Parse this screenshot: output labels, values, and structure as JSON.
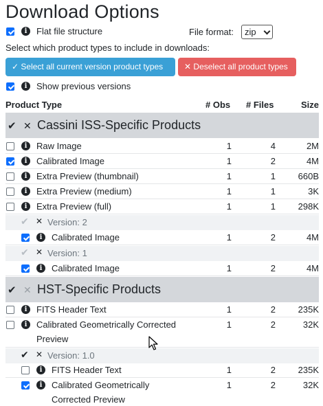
{
  "title": "Download Options",
  "flat_file": {
    "label": "Flat file structure",
    "checked": true
  },
  "file_format": {
    "label": "File format:",
    "value": "zip"
  },
  "select_prompt": "Select which product types to include in downloads:",
  "buttons": {
    "select_all": "Select all current version product types",
    "deselect_all": "Deselect all product types"
  },
  "show_prev": {
    "label": "Show previous versions",
    "checked": true
  },
  "table_headers": {
    "product_type": "Product Type",
    "obs": "# Obs",
    "files": "# Files",
    "size": "Size"
  },
  "sections": [
    {
      "title": "Cassini ISS-Specific Products",
      "rows": [
        {
          "name": "Raw Image",
          "checked": false,
          "obs": "1",
          "files": "4",
          "size": "2M"
        },
        {
          "name": "Calibrated Image",
          "checked": true,
          "obs": "1",
          "files": "2",
          "size": "4M"
        },
        {
          "name": "Extra Preview (thumbnail)",
          "checked": false,
          "obs": "1",
          "files": "1",
          "size": "660B"
        },
        {
          "name": "Extra Preview (medium)",
          "checked": false,
          "obs": "1",
          "files": "1",
          "size": "3K"
        },
        {
          "name": "Extra Preview (full)",
          "checked": false,
          "obs": "1",
          "files": "1",
          "size": "298K"
        }
      ],
      "versions": [
        {
          "label": "Version: 2",
          "rows": [
            {
              "name": "Calibrated Image",
              "checked": true,
              "obs": "1",
              "files": "2",
              "size": "4M"
            }
          ]
        },
        {
          "label": "Version: 1",
          "rows": [
            {
              "name": "Calibrated Image",
              "checked": true,
              "obs": "1",
              "files": "2",
              "size": "4M"
            }
          ]
        }
      ]
    },
    {
      "title": "HST-Specific Products",
      "rows": [
        {
          "name": "FITS Header Text",
          "checked": false,
          "obs": "1",
          "files": "2",
          "size": "235K"
        },
        {
          "name_line1": "Calibrated Geometrically Corrected",
          "name_line2": "Preview",
          "checked": false,
          "obs": "1",
          "files": "2",
          "size": "32K"
        }
      ],
      "versions": [
        {
          "label": "Version: 1.0",
          "rows": [
            {
              "name": "FITS Header Text",
              "checked": false,
              "obs": "1",
              "files": "2",
              "size": "235K"
            },
            {
              "name_line1": "Calibrated Geometrically",
              "name_line2": "Corrected Preview",
              "checked": true,
              "obs": "1",
              "files": "2",
              "size": "32K"
            }
          ]
        }
      ]
    }
  ],
  "colors": {
    "primary_button": "#3aa0d6",
    "danger_button": "#e65f5f",
    "checkbox_checked": "#0d6efd",
    "section_bg": "#d4d7db"
  }
}
